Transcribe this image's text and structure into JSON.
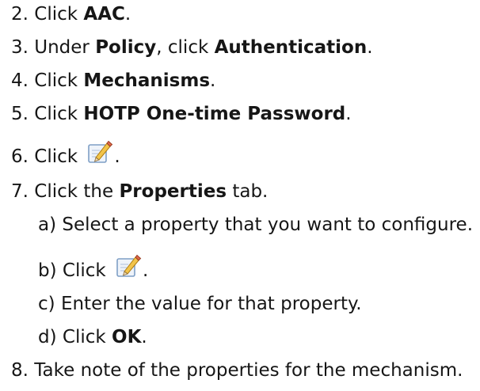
{
  "steps": [
    {
      "num": "2.",
      "pre": "Click ",
      "bold": "AAC",
      "post": "."
    },
    {
      "num": "3.",
      "pre": "Under ",
      "bold": "Policy",
      "mid": ", click ",
      "bold2": "Authentication",
      "post": "."
    },
    {
      "num": "4.",
      "pre": "Click ",
      "bold": "Mechanisms",
      "post": "."
    },
    {
      "num": "5.",
      "pre": "Click ",
      "bold": "HOTP One-time Password",
      "post": "."
    },
    {
      "num": "6.",
      "pre": "Click ",
      "icon": "edit-icon",
      "post": "."
    },
    {
      "num": "7.",
      "pre": "Click the ",
      "bold": "Properties",
      "post": " tab."
    },
    {
      "num": "8.",
      "text": "Take note of the properties for the mechanism."
    }
  ],
  "substeps": [
    {
      "letter": "a)",
      "text": "Select a property that you want to configure."
    },
    {
      "letter": "b)",
      "pre": "Click ",
      "icon": "edit-icon",
      "post": "."
    },
    {
      "letter": "c)",
      "text": "Enter the value for that property."
    },
    {
      "letter": "d)",
      "pre": "Click ",
      "bold": "OK",
      "post": "."
    }
  ]
}
